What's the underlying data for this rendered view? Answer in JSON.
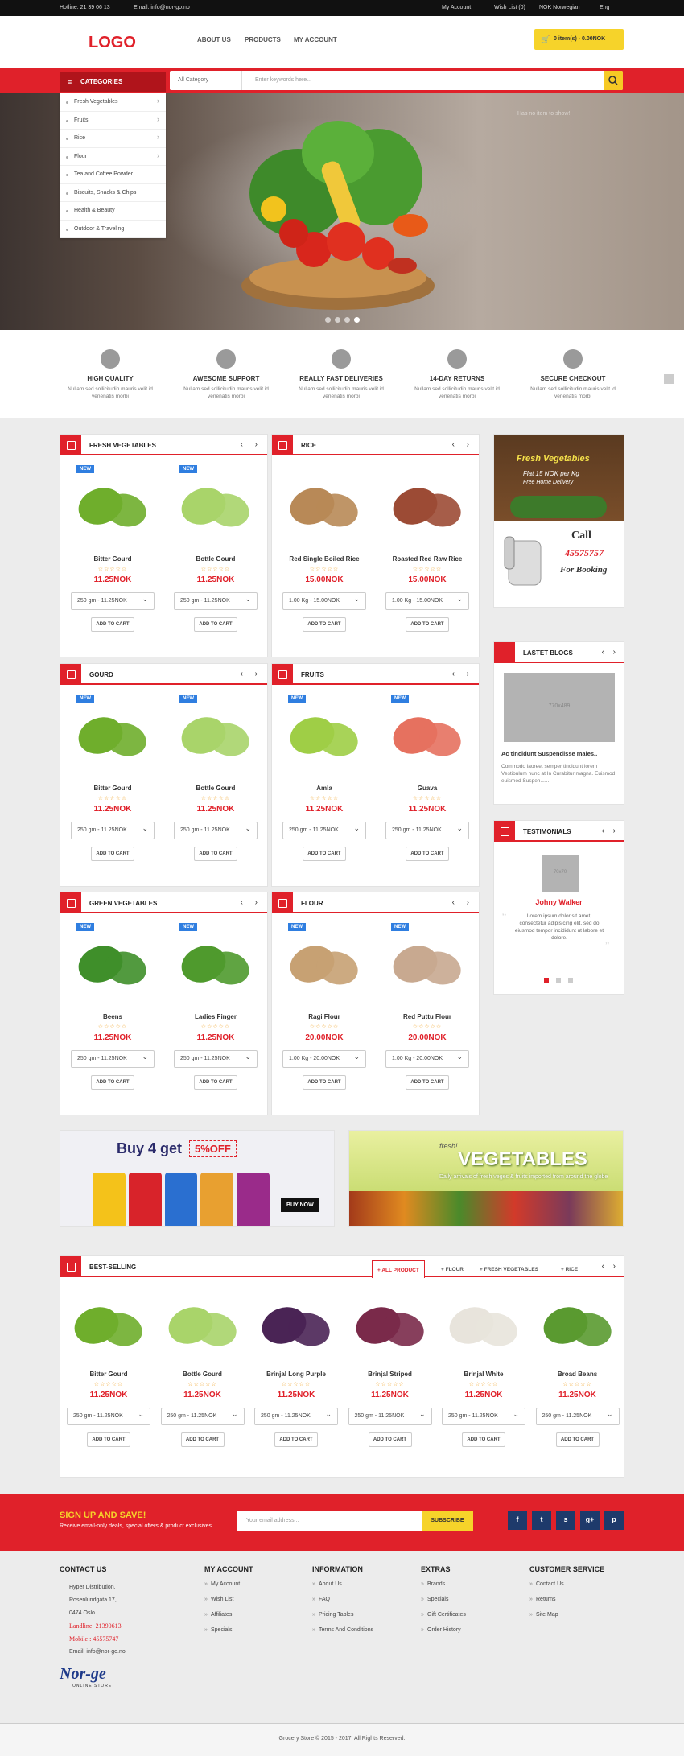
{
  "topbar": {
    "hotline": "Hotline: 21 39 06 13",
    "email": "Email: info@nor-go.no",
    "my_account": "My Account",
    "wishlist": "Wish List (0)",
    "currency": "NOK Norwegian",
    "lang": "Eng"
  },
  "header": {
    "logo": "LOGO",
    "nav": [
      "ABOUT US",
      "PRODUCTS",
      "MY ACCOUNT"
    ],
    "cart": "0 item(s) - 0.00NOK"
  },
  "categories": {
    "button": "CATEGORIES",
    "items": [
      "Fresh Vegetables",
      "Fruits",
      "Rice",
      "Flour",
      "Tea and Coffee Powder",
      "Biscuits, Snacks & Chips",
      "Health & Beauty",
      "Outdoor & Traveling"
    ]
  },
  "search": {
    "category": "All Category",
    "placeholder": "Enter keywords here..."
  },
  "hero": {
    "note": "Has no item to show!"
  },
  "features": [
    {
      "title": "HIGH QUALITY",
      "desc": "Nullam sed sollicitudin mauris velit id venenatis morbi"
    },
    {
      "title": "AWESOME SUPPORT",
      "desc": "Nullam sed sollicitudin mauris velit id venenatis morbi"
    },
    {
      "title": "REALLY FAST DELIVERIES",
      "desc": "Nullam sed sollicitudin mauris velit id venenatis morbi"
    },
    {
      "title": "14-DAY RETURNS",
      "desc": "Nullam sed sollicitudin mauris velit id venenatis morbi"
    },
    {
      "title": "SECURE CHECKOUT",
      "desc": "Nullam sed sollicitudin mauris velit id venenatis morbi"
    }
  ],
  "panels": [
    {
      "title": "FRESH VEGETABLES",
      "products": [
        {
          "name": "Bitter Gourd",
          "price": "11.25NOK",
          "option": "250 gm - 11.25NOK",
          "new": "NEW",
          "color": "#6fae2c"
        },
        {
          "name": "Bottle Gourd",
          "price": "11.25NOK",
          "option": "250 gm - 11.25NOK",
          "new": "NEW",
          "color": "#a9d46a"
        }
      ]
    },
    {
      "title": "RICE",
      "products": [
        {
          "name": "Red Single Boiled Rice",
          "price": "15.00NOK",
          "option": "1.00 Kg - 15.00NOK",
          "new": "",
          "color": "#b88957"
        },
        {
          "name": "Roasted Red Raw Rice",
          "price": "15.00NOK",
          "option": "1.00 Kg - 15.00NOK",
          "new": "",
          "color": "#9c4b35"
        }
      ]
    },
    {
      "title": "GOURD",
      "products": [
        {
          "name": "Bitter Gourd",
          "price": "11.25NOK",
          "option": "250 gm - 11.25NOK",
          "new": "NEW",
          "color": "#6fae2c"
        },
        {
          "name": "Bottle Gourd",
          "price": "11.25NOK",
          "option": "250 gm - 11.25NOK",
          "new": "NEW",
          "color": "#a9d46a"
        }
      ]
    },
    {
      "title": "FRUITS",
      "products": [
        {
          "name": "Amla",
          "price": "11.25NOK",
          "option": "250 gm - 11.25NOK",
          "new": "NEW",
          "color": "#9fce46"
        },
        {
          "name": "Guava",
          "price": "11.25NOK",
          "option": "250 gm - 11.25NOK",
          "new": "NEW",
          "color": "#e6715f"
        }
      ]
    },
    {
      "title": "GREEN VEGETABLES",
      "products": [
        {
          "name": "Beens",
          "price": "11.25NOK",
          "option": "250 gm - 11.25NOK",
          "new": "NEW",
          "color": "#3f8f2a"
        },
        {
          "name": "Ladies Finger",
          "price": "11.25NOK",
          "option": "250 gm - 11.25NOK",
          "new": "NEW",
          "color": "#4f9a2d"
        }
      ]
    },
    {
      "title": "FLOUR",
      "products": [
        {
          "name": "Ragi Flour",
          "price": "20.00NOK",
          "option": "1.00 Kg - 20.00NOK",
          "new": "NEW",
          "color": "#c7a173"
        },
        {
          "name": "Red Puttu Flour",
          "price": "20.00NOK",
          "option": "1.00 Kg - 20.00NOK",
          "new": "NEW",
          "color": "#c8a990"
        }
      ]
    }
  ],
  "stars": "☆☆☆☆☆",
  "add_to_cart": "ADD TO CART",
  "ad": {
    "title": "Fresh Vegetables",
    "line1": "Flat 15 NOK per Kg",
    "line2": "Free Home Delivery",
    "call": "Call",
    "phone": "45575757",
    "booking": "For Booking"
  },
  "blogs": {
    "title": "LASTET BLOGS",
    "placeholder": "770x489",
    "post_title": "Ac tincidunt Suspendisse males..",
    "post_text": "Commodo laoreet semper tincidunt lorem Vestibulum nunc at In Curabitur magna. Euismod euismod Suspen......"
  },
  "testimonials": {
    "title": "TESTIMONIALS",
    "placeholder": "70x70",
    "name": "Johny Walker",
    "text": "Lorem ipsum dolor sit amet, consectetur adipisicing elit, sed do eiusmod tempor incididunt ut labore et dolore."
  },
  "banners": {
    "promo": "Buy 4 get",
    "promo_off": "5%OFF",
    "promo_btn": "BUY NOW",
    "veg_small": "fresh!",
    "veg_title": "VEGETABLES",
    "veg_sub": "Daily arrivals of fresh veges & fruits imported from around the globe"
  },
  "bestselling": {
    "title": "BEST-SELLING",
    "tabs": [
      "+ ALL PRODUCT",
      "+ FLOUR",
      "+ FRESH VEGETABLES",
      "+ RICE"
    ],
    "products": [
      {
        "name": "Bitter Gourd",
        "color": "#6fae2c"
      },
      {
        "name": "Bottle Gourd",
        "color": "#a9d46a"
      },
      {
        "name": "Brinjal Long Purple",
        "color": "#4a2455"
      },
      {
        "name": "Brinjal Striped",
        "color": "#7a2a4a"
      },
      {
        "name": "Brinjal White",
        "color": "#e8e4dc"
      },
      {
        "name": "Broad Beans",
        "color": "#5a9a30"
      }
    ],
    "price": "11.25NOK",
    "option": "250 gm - 11.25NOK"
  },
  "newsletter": {
    "title": "SIGN UP AND SAVE!",
    "subtitle": "Receive email-only deals, special offers & product exclusives",
    "placeholder": "Your email address...",
    "button": "SUBSCRIBE"
  },
  "social": [
    "f",
    "t",
    "s",
    "g+",
    "p"
  ],
  "footer": {
    "contact": {
      "title": "CONTACT US",
      "address1": "Hyper Distribution,",
      "address2": "Rosenlundgata 17,",
      "address3": "0474 Oslo.",
      "landline": "Landline: 21390613",
      "mobile": "Mobile : 45575747",
      "email": "Email: info@nor-go.no",
      "brand": "Nor-ge",
      "brand_sub": "ONLINE STORE"
    },
    "columns": [
      {
        "title": "MY ACCOUNT",
        "items": [
          "My Account",
          "Wish List",
          "Affiliates",
          "Specials"
        ]
      },
      {
        "title": "INFORMATION",
        "items": [
          "About Us",
          "FAQ",
          "Pricing Tables",
          "Terms And Conditions"
        ]
      },
      {
        "title": "EXTRAS",
        "items": [
          "Brands",
          "Specials",
          "Gift Certificates",
          "Order History"
        ]
      },
      {
        "title": "CUSTOMER SERVICE",
        "items": [
          "Contact Us",
          "Returns",
          "Site Map"
        ]
      }
    ],
    "copyright": "Grocery Store © 2015 - 2017. All Rights Reserved."
  },
  "colors": {
    "accent": "#e0212a",
    "yellow": "#f6c924",
    "badge": "#2f7ee0"
  }
}
